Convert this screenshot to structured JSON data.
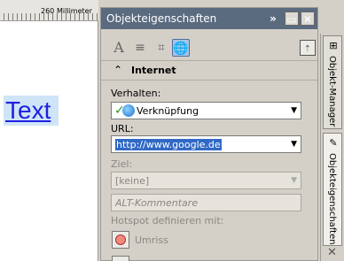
{
  "ruler": {
    "number": "260",
    "unit": "Millimeter"
  },
  "canvas": {
    "text": "Text"
  },
  "panel": {
    "title": "Objekteigenschaften",
    "section": "Internet",
    "behavior": {
      "label": "Verhalten:",
      "value": "Verknüpfung"
    },
    "url": {
      "label": "URL:",
      "value": "http://www.google.de"
    },
    "target": {
      "label": "Ziel:",
      "value": "[keine]"
    },
    "alt": {
      "placeholder": "ALT-Kommentare"
    },
    "hotspot": {
      "label": "Hotspot definieren mit:",
      "option": "Umriss"
    }
  },
  "tabs": {
    "object_manager": "Objekt-Manager",
    "object_properties": "Objekteigenschaften"
  },
  "icons": [
    "character-icon",
    "paragraph-icon",
    "frame-icon",
    "internet-icon",
    "export-icon",
    "globe-icon",
    "checkmark-icon",
    "close-icon",
    "minimize-icon",
    "collapse-icon"
  ]
}
